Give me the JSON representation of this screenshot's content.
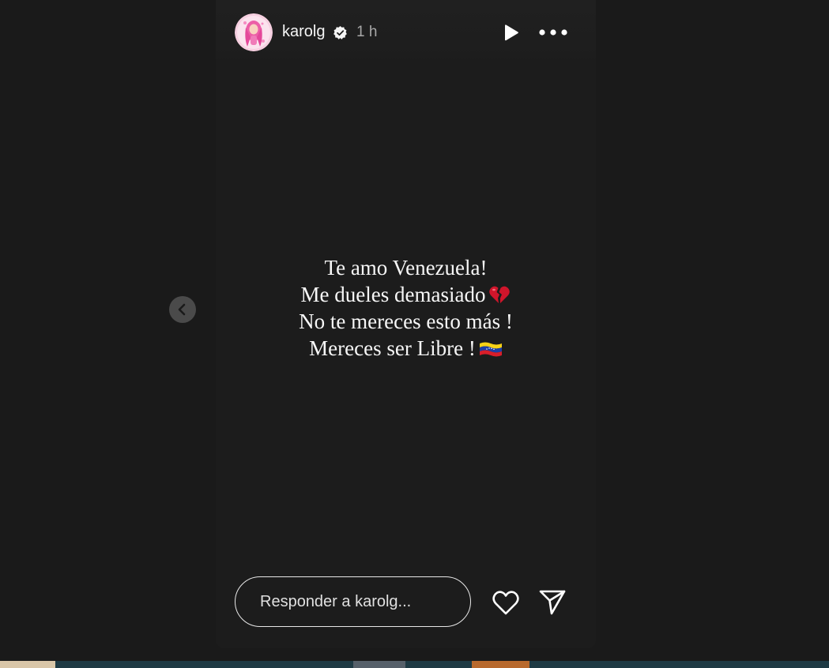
{
  "story": {
    "username": "karolg",
    "time_ago": "1 h",
    "text_lines": [
      "Te amo Venezuela!",
      "Me dueles demasiado",
      "No te mereces esto más !",
      "Mereces ser Libre !"
    ],
    "emoji": {
      "line2": "broken-heart-icon",
      "line4": "venezuela-flag-icon"
    }
  },
  "reply": {
    "placeholder": "Responder a karolg..."
  },
  "icons": {
    "verified": "verified-badge-icon",
    "play": "play-icon",
    "more": "more-options-icon",
    "like": "heart-icon",
    "share": "send-icon",
    "previous": "chevron-left-icon"
  },
  "colors": {
    "page_background": "#1a1a1a",
    "story_background": "#1c1c1c",
    "text": "#f5f5f5",
    "muted_text": "#a8a8a8"
  }
}
